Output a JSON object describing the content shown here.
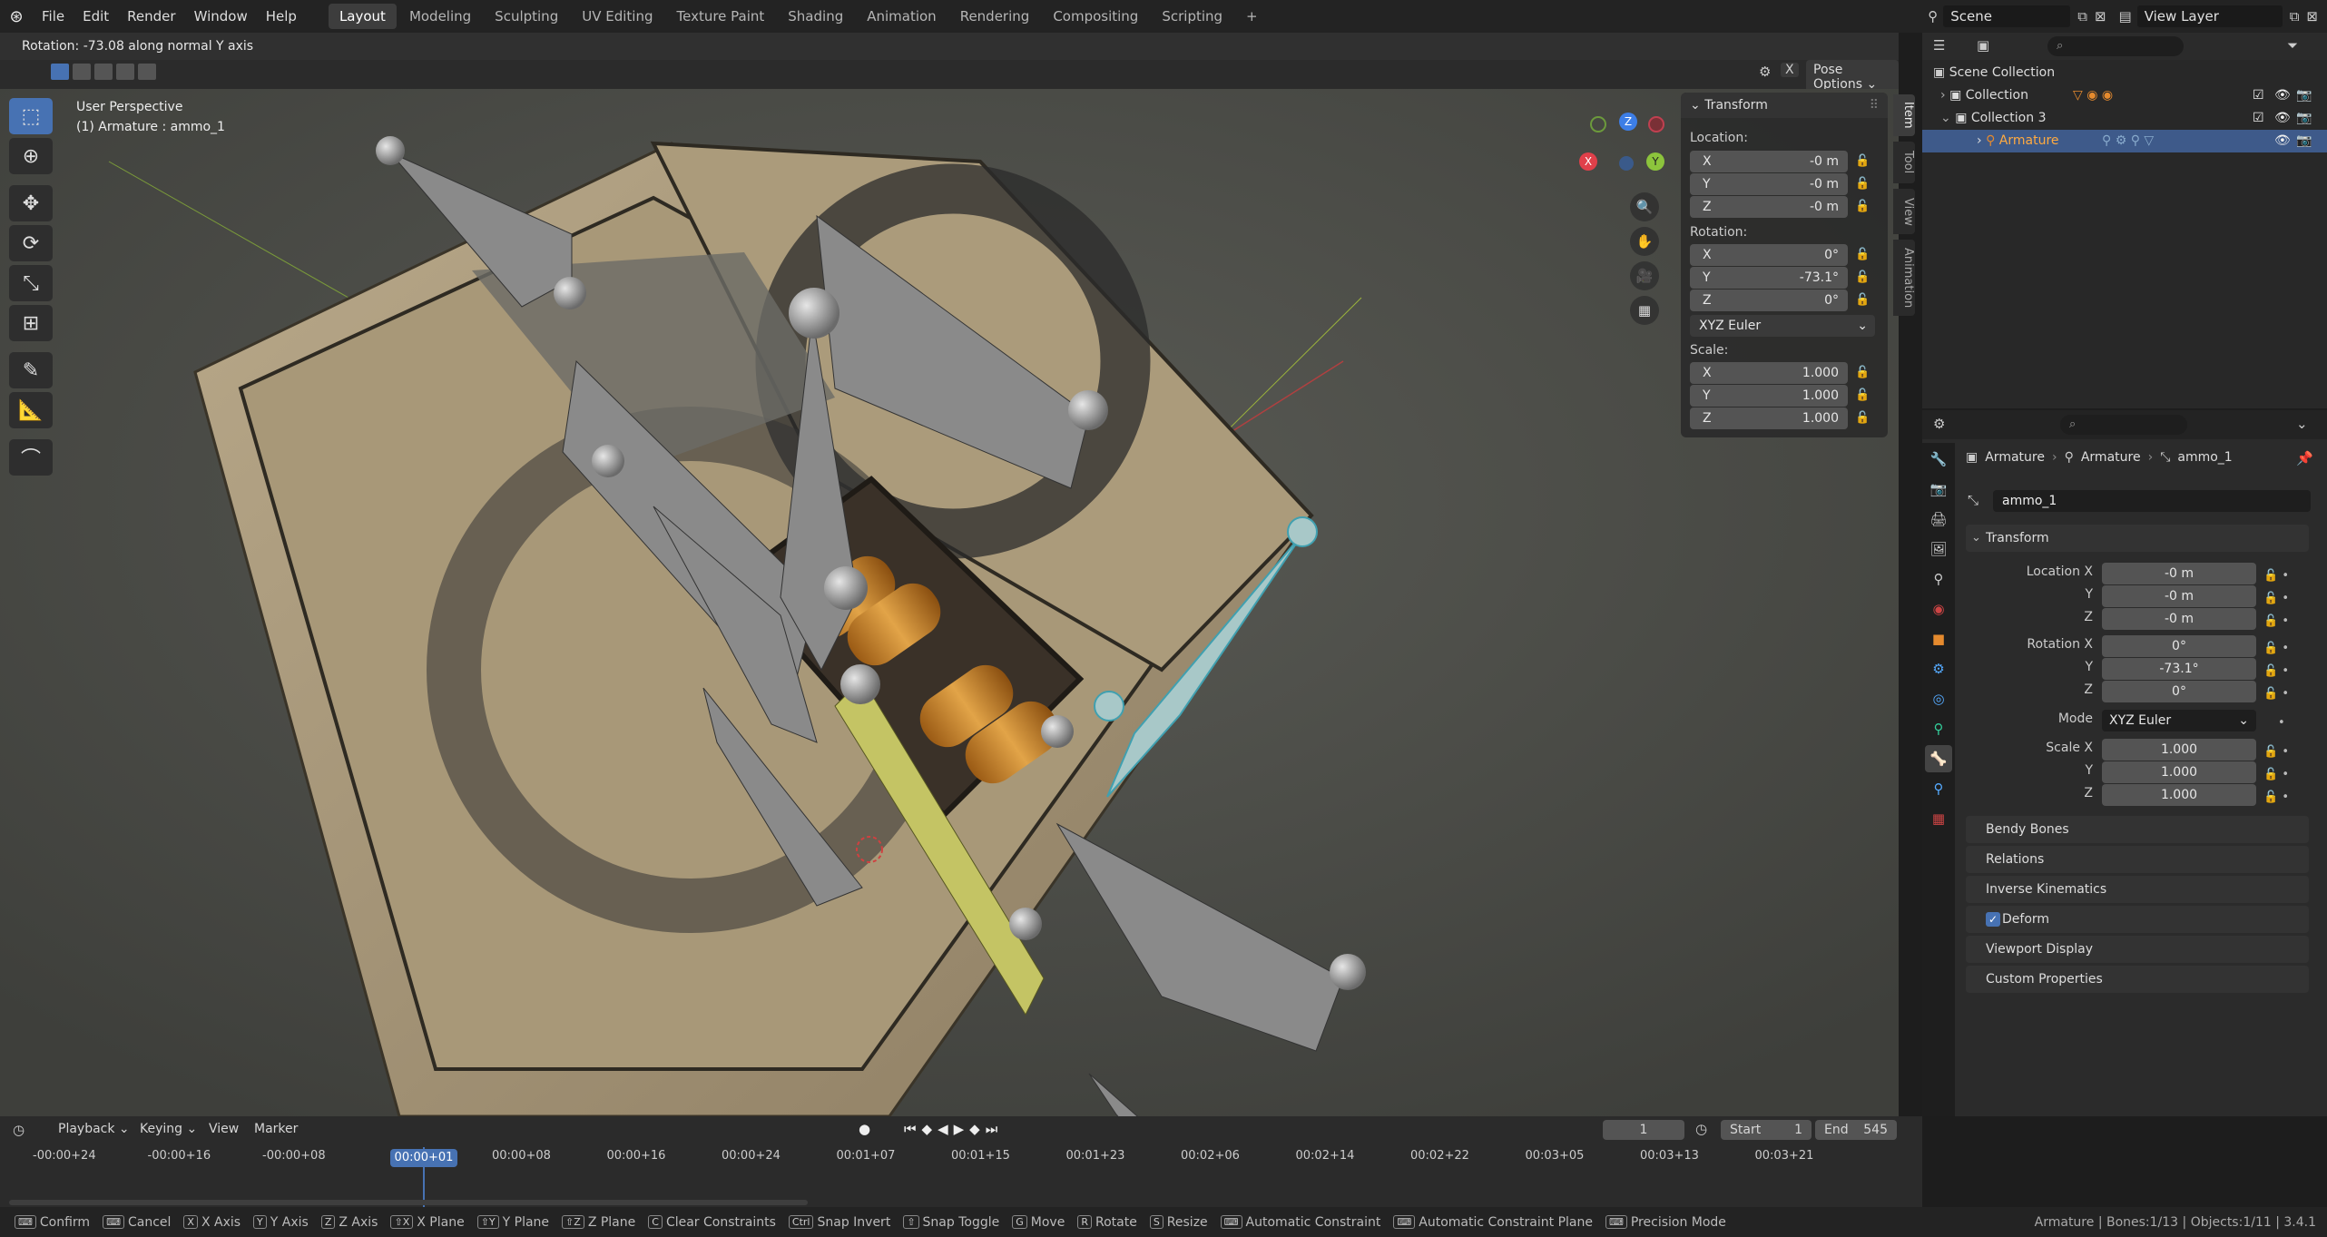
{
  "menu": {
    "items": [
      "File",
      "Edit",
      "Render",
      "Window",
      "Help"
    ]
  },
  "workspaces": {
    "tabs": [
      "Layout",
      "Modeling",
      "Sculpting",
      "UV Editing",
      "Texture Paint",
      "Shading",
      "Animation",
      "Rendering",
      "Compositing",
      "Scripting"
    ],
    "active": "Layout",
    "add": "+"
  },
  "scene": {
    "name": "Scene",
    "view_layer": "View Layer"
  },
  "viewport": {
    "status": "Rotation: -73.08 along normal Y axis",
    "pose_options": "Pose Options",
    "perspective": "User Perspective",
    "object_info": "(1) Armature : ammo_1",
    "gizmo": {
      "z": "Z",
      "y": "Y",
      "x": "X"
    }
  },
  "npanel": {
    "title": "Transform",
    "location_label": "Location:",
    "location": [
      {
        "axis": "X",
        "value": "-0 m"
      },
      {
        "axis": "Y",
        "value": "-0 m"
      },
      {
        "axis": "Z",
        "value": "-0 m"
      }
    ],
    "rotation_label": "Rotation:",
    "rotation": [
      {
        "axis": "X",
        "value": "0°"
      },
      {
        "axis": "Y",
        "value": "-73.1°"
      },
      {
        "axis": "Z",
        "value": "0°"
      }
    ],
    "rotation_mode": "XYZ Euler",
    "scale_label": "Scale:",
    "scale": [
      {
        "axis": "X",
        "value": "1.000"
      },
      {
        "axis": "Y",
        "value": "1.000"
      },
      {
        "axis": "Z",
        "value": "1.000"
      }
    ],
    "tabs": [
      "Item",
      "Tool",
      "View",
      "Animation"
    ]
  },
  "outliner": {
    "rows": [
      {
        "label": "Scene Collection"
      },
      {
        "label": "Collection"
      },
      {
        "label": "Collection 3"
      },
      {
        "label": "Armature"
      }
    ]
  },
  "properties": {
    "breadcrumb": [
      "Armature",
      "Armature",
      "ammo_1"
    ],
    "bone_name": "ammo_1",
    "transform_title": "Transform",
    "location_x_label": "Location X",
    "y_label": "Y",
    "z_label": "Z",
    "location": [
      "-0 m",
      "-0 m",
      "-0 m"
    ],
    "rotation_x_label": "Rotation X",
    "rotation": [
      "0°",
      "-73.1°",
      "0°"
    ],
    "mode_label": "Mode",
    "mode": "XYZ Euler",
    "scale_x_label": "Scale X",
    "scale": [
      "1.000",
      "1.000",
      "1.000"
    ],
    "panels": [
      "Bendy Bones",
      "Relations",
      "Inverse Kinematics",
      "Deform",
      "Viewport Display",
      "Custom Properties"
    ]
  },
  "timeline": {
    "menus": [
      "Playback",
      "Keying",
      "View",
      "Marker"
    ],
    "current_frame": "1",
    "start_label": "Start",
    "start": "1",
    "end_label": "End",
    "end": "545",
    "ticks": [
      "-00:00+24",
      "-00:00+16",
      "-00:00+08",
      "00:00+01",
      "00:00+08",
      "00:00+16",
      "00:00+24",
      "00:01+07",
      "00:01+15",
      "00:01+23",
      "00:02+06",
      "00:02+14",
      "00:02+22",
      "00:03+05",
      "00:03+13",
      "00:03+21"
    ],
    "current_time": "00:00+01"
  },
  "statusbar": {
    "items": [
      {
        "key": "",
        "label": "Confirm"
      },
      {
        "key": "",
        "label": "Cancel"
      },
      {
        "key": "X",
        "label": "X Axis"
      },
      {
        "key": "Y",
        "label": "Y Axis"
      },
      {
        "key": "Z",
        "label": "Z Axis"
      },
      {
        "key": "⇧X",
        "label": "X Plane"
      },
      {
        "key": "⇧Y",
        "label": "Y Plane"
      },
      {
        "key": "⇧Z",
        "label": "Z Plane"
      },
      {
        "key": "C",
        "label": "Clear Constraints"
      },
      {
        "key": "Ctrl",
        "label": "Snap Invert"
      },
      {
        "key": "⇧",
        "label": "Snap Toggle"
      },
      {
        "key": "G",
        "label": "Move"
      },
      {
        "key": "R",
        "label": "Rotate"
      },
      {
        "key": "S",
        "label": "Resize"
      },
      {
        "key": "",
        "label": "Automatic Constraint"
      },
      {
        "key": "",
        "label": "Automatic Constraint Plane"
      },
      {
        "key": "",
        "label": "Precision Mode"
      }
    ],
    "info": "Armature | Bones:1/13 | Objects:1/11 | 3.4.1"
  },
  "colors": {
    "accent": "#4772b3",
    "selected_bone": "#a8c8c8",
    "active_bone": "#c4c464",
    "bone": "#8a8a8a"
  }
}
